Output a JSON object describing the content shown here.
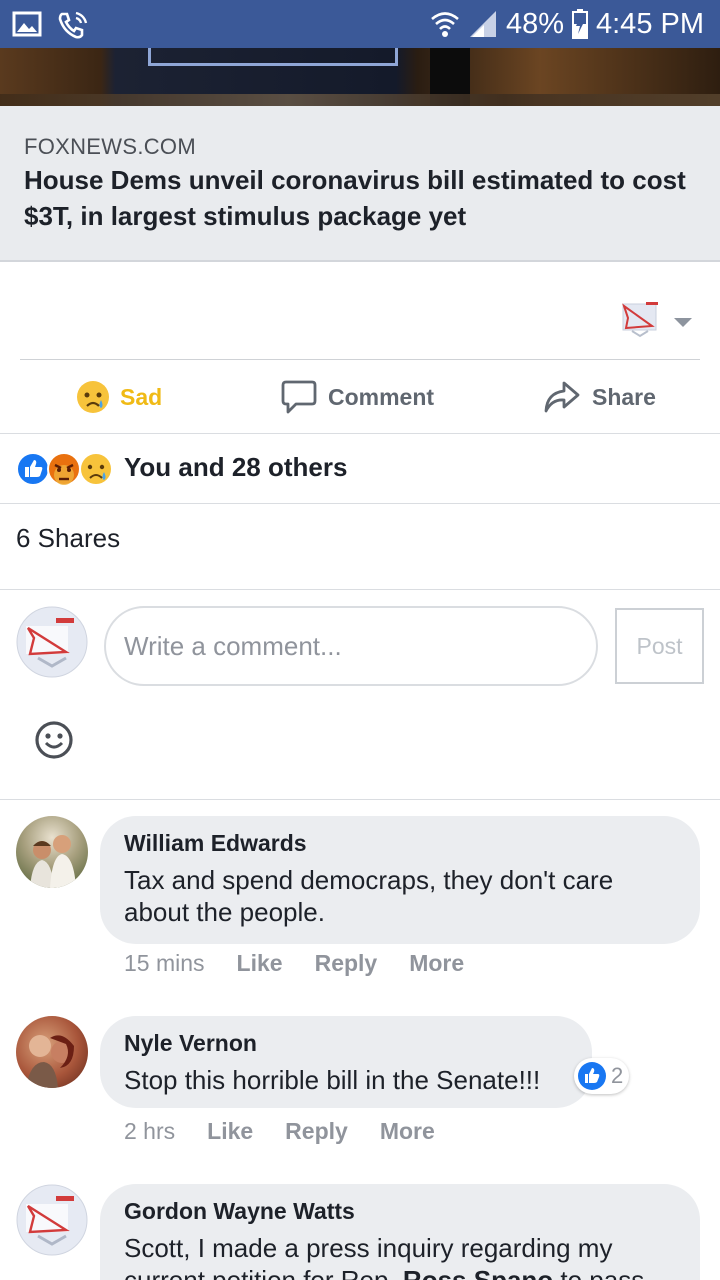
{
  "status_bar": {
    "battery": "48%",
    "time": "4:45 PM",
    "left_icons": [
      "image-icon",
      "wifi-call-icon"
    ],
    "right_icons": [
      "wifi-icon",
      "signal-icon",
      "battery-charging-icon"
    ]
  },
  "link_preview": {
    "source": "FOXNEWS.COM",
    "title": "House Dems unveil coronavirus bill estimated to cost $3T, in largest stimulus package yet"
  },
  "actions": {
    "sad_label": "Sad",
    "comment_label": "Comment",
    "share_label": "Share"
  },
  "reactions": {
    "icons": [
      "like-icon",
      "angry-icon",
      "sad-icon"
    ],
    "summary": "You and 28 others"
  },
  "shares": {
    "text": "6 Shares"
  },
  "composer": {
    "placeholder": "Write a comment...",
    "post_label": "Post"
  },
  "comments": [
    {
      "name": "William Edwards",
      "text": "Tax and spend democraps, they don't care about the people.",
      "time": "15 mins",
      "like": "Like",
      "reply": "Reply",
      "more": "More"
    },
    {
      "name": "Nyle Vernon",
      "text": "Stop this horrible bill in the Senate!!!",
      "time": "2 hrs",
      "like": "Like",
      "reply": "Reply",
      "more": "More",
      "likes_count": "2"
    },
    {
      "name": "Gordon Wayne Watts",
      "text_start": "Scott, I made a press inquiry regarding my current petition for Rep. ",
      "text_bold": "Ross Spano",
      "text_end": " to pass"
    }
  ],
  "colors": {
    "status_bar": "#3b5998",
    "sad_reaction": "#f0ba15",
    "like_blue": "#1877f2",
    "bubble": "#ebedf0"
  }
}
